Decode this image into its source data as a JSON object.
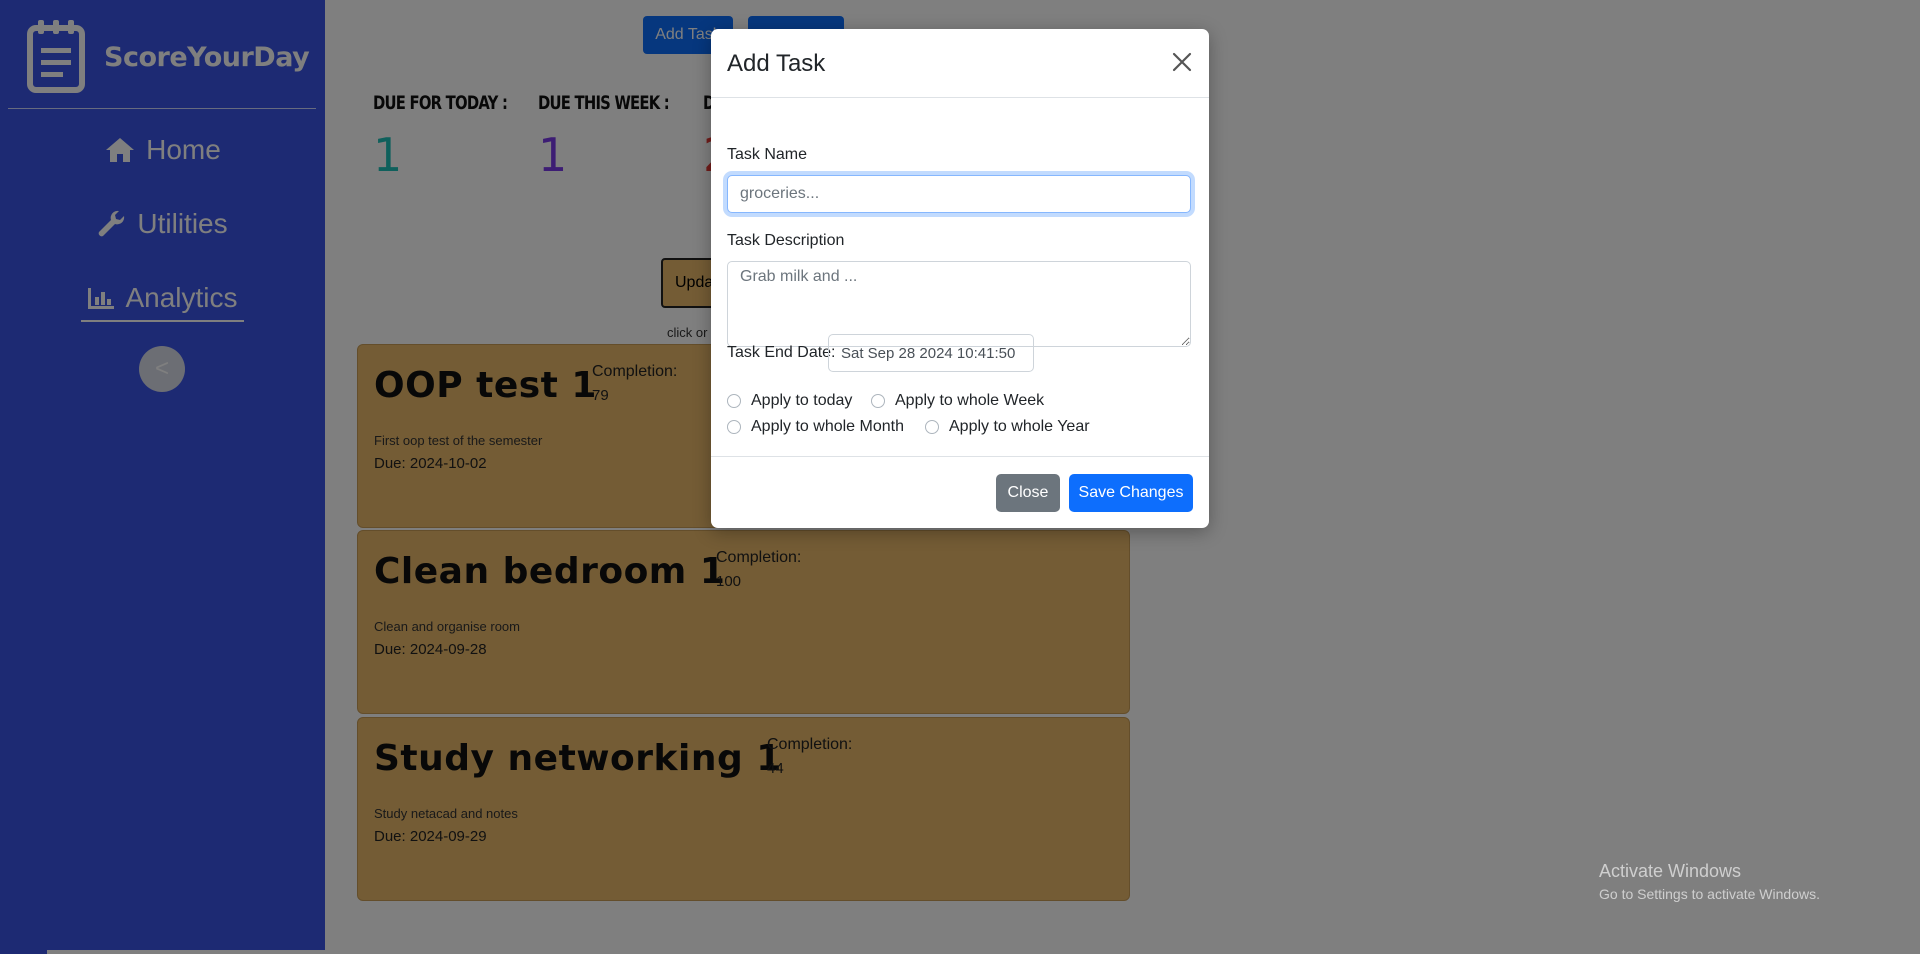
{
  "sidebar": {
    "brand": "ScoreYourDay",
    "nav": [
      {
        "label": "Home",
        "icon": "home-icon"
      },
      {
        "label": "Utilities",
        "icon": "wrench-icon"
      },
      {
        "label": "Analytics",
        "icon": "chart-icon"
      }
    ],
    "collapse_label": "<"
  },
  "toolbar": {
    "add_task_label": "Add Task",
    "second_button_label": ""
  },
  "stats": [
    {
      "label": "DUE FOR TODAY :",
      "value": "1",
      "color": "#1fc1b8"
    },
    {
      "label": "DUE THIS WEEK :",
      "value": "1",
      "color": "#7a3ae8"
    },
    {
      "label": "D",
      "value": "2",
      "color": "#e53935"
    }
  ],
  "update_label": "Upda",
  "hint_text": "click or",
  "tasks": [
    {
      "title": "OOP test 1",
      "completion_label": "Completion:",
      "completion": "79",
      "description": "First oop test of the semester",
      "due": "Due: 2024-10-02"
    },
    {
      "title": "Clean bedroom 1",
      "completion_label": "Completion:",
      "completion": "100",
      "description": "Clean and organise room",
      "due": "Due: 2024-09-28"
    },
    {
      "title": "Study networking 1",
      "completion_label": "Completion:",
      "completion": "44",
      "description": "Study netacad and notes",
      "due": "Due: 2024-09-29"
    }
  ],
  "modal": {
    "title": "Add Task",
    "task_name_label": "Task Name",
    "task_name_placeholder": "groceries...",
    "task_desc_label": "Task Description",
    "task_desc_placeholder": "Grab milk and ...",
    "end_date_label": "Task End Date:",
    "end_date_value": "Sat Sep 28 2024 10:41:50",
    "radios": [
      "Apply to today",
      "Apply to whole Week",
      "Apply to whole Month",
      "Apply to whole Year"
    ],
    "close_label": "Close",
    "save_label": "Save Changes"
  },
  "watermark": {
    "title": "Activate Windows",
    "subtitle": "Go to Settings to activate Windows."
  }
}
